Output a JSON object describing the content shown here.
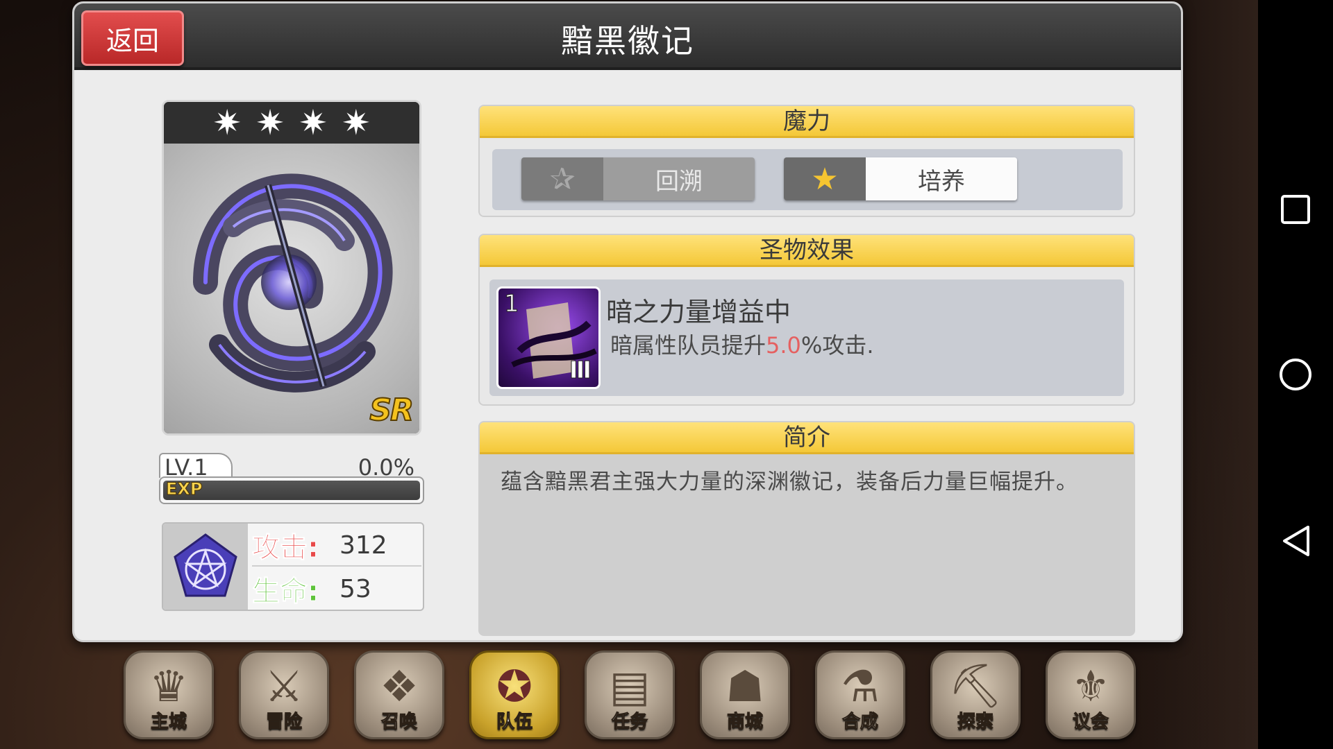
{
  "header": {
    "title": "黯黑徽记",
    "back_label": "返回"
  },
  "item": {
    "stars": 4,
    "rarity": "SR",
    "level_label": "LV.1",
    "exp_percent_text": "0.0%",
    "exp_fraction": 0.0,
    "exp_label": "EXP",
    "stats": {
      "attack_label": "攻击:",
      "attack_value": "312",
      "hp_label": "生命:",
      "hp_value": "53"
    }
  },
  "magic": {
    "heading": "魔力",
    "revert_label": "回溯",
    "train_label": "培养"
  },
  "relic": {
    "heading": "圣物效果",
    "level": "1",
    "roman": "Ⅲ",
    "name": "暗之力量增益中",
    "desc_before": "暗属性队员提升",
    "desc_value": "5.0",
    "desc_after": "%攻击."
  },
  "intro": {
    "heading": "简介",
    "text": "蕴含黯黑君主强大力量的深渊徽记，装备后力量巨幅提升。"
  },
  "dock": [
    {
      "label": "主城",
      "icon": "crown-icon",
      "glyph": "♛",
      "active": false
    },
    {
      "label": "冒险",
      "icon": "weapons-icon",
      "glyph": "⚔",
      "active": false
    },
    {
      "label": "召唤",
      "icon": "card-icon",
      "glyph": "❖",
      "active": false
    },
    {
      "label": "队伍",
      "icon": "wings-emblem-icon",
      "glyph": "✪",
      "active": true
    },
    {
      "label": "任务",
      "icon": "book-icon",
      "glyph": "▤",
      "active": false
    },
    {
      "label": "商城",
      "icon": "mushroom-icon",
      "glyph": "☗",
      "active": false
    },
    {
      "label": "合成",
      "icon": "potion-icon",
      "glyph": "⚗",
      "active": false
    },
    {
      "label": "探索",
      "icon": "shovel-icon",
      "glyph": "⛏",
      "active": false
    },
    {
      "label": "议会",
      "icon": "council-emblem-icon",
      "glyph": "⚜",
      "active": false
    }
  ],
  "colors": {
    "attack_label": "#e84a4a",
    "hp_label": "#5ec33a",
    "accent_yellow": "#f4c838",
    "back_red": "#d23a3a"
  }
}
